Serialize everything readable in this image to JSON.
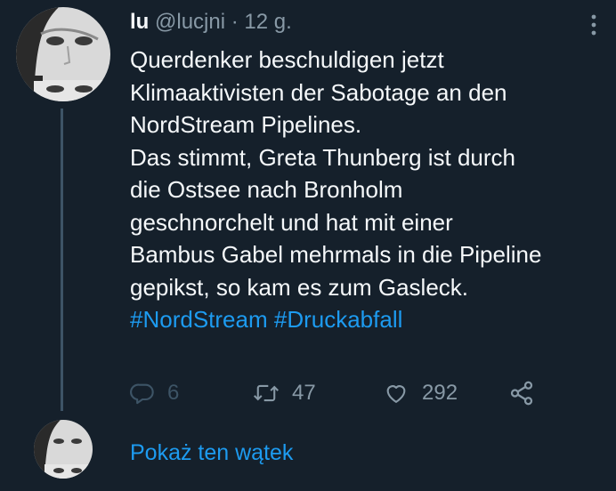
{
  "tweet": {
    "display_name": "lu",
    "handle": "@lucjni",
    "separator": "·",
    "time": "12 g.",
    "lines": [
      "Querdenker beschuldigen jetzt",
      "Klimaaktivisten der Sabotage an den",
      "NordStream Pipelines.",
      "Das stimmt, Greta Thunberg ist durch",
      "die Ostsee nach Bronholm",
      "geschnorchelt und hat mit einer",
      "Bambus Gabel mehrmals in die Pipeline",
      "gepikst, so kam es zum Gasleck."
    ],
    "hashtags": [
      "#NordStream",
      "#Druckabfall"
    ]
  },
  "actions": {
    "reply_count": "6",
    "retweet_count": "47",
    "like_count": "292"
  },
  "thread_link": "Pokaż ten wątek",
  "colors": {
    "background": "#15202b",
    "text": "#f5f8fa",
    "muted": "#8899a6",
    "accent": "#1d9bf0",
    "thread_line": "#3d5466"
  },
  "icons": {
    "more": "more-vertical-icon",
    "reply": "reply-icon",
    "retweet": "retweet-icon",
    "like": "heart-icon",
    "share": "share-icon"
  }
}
